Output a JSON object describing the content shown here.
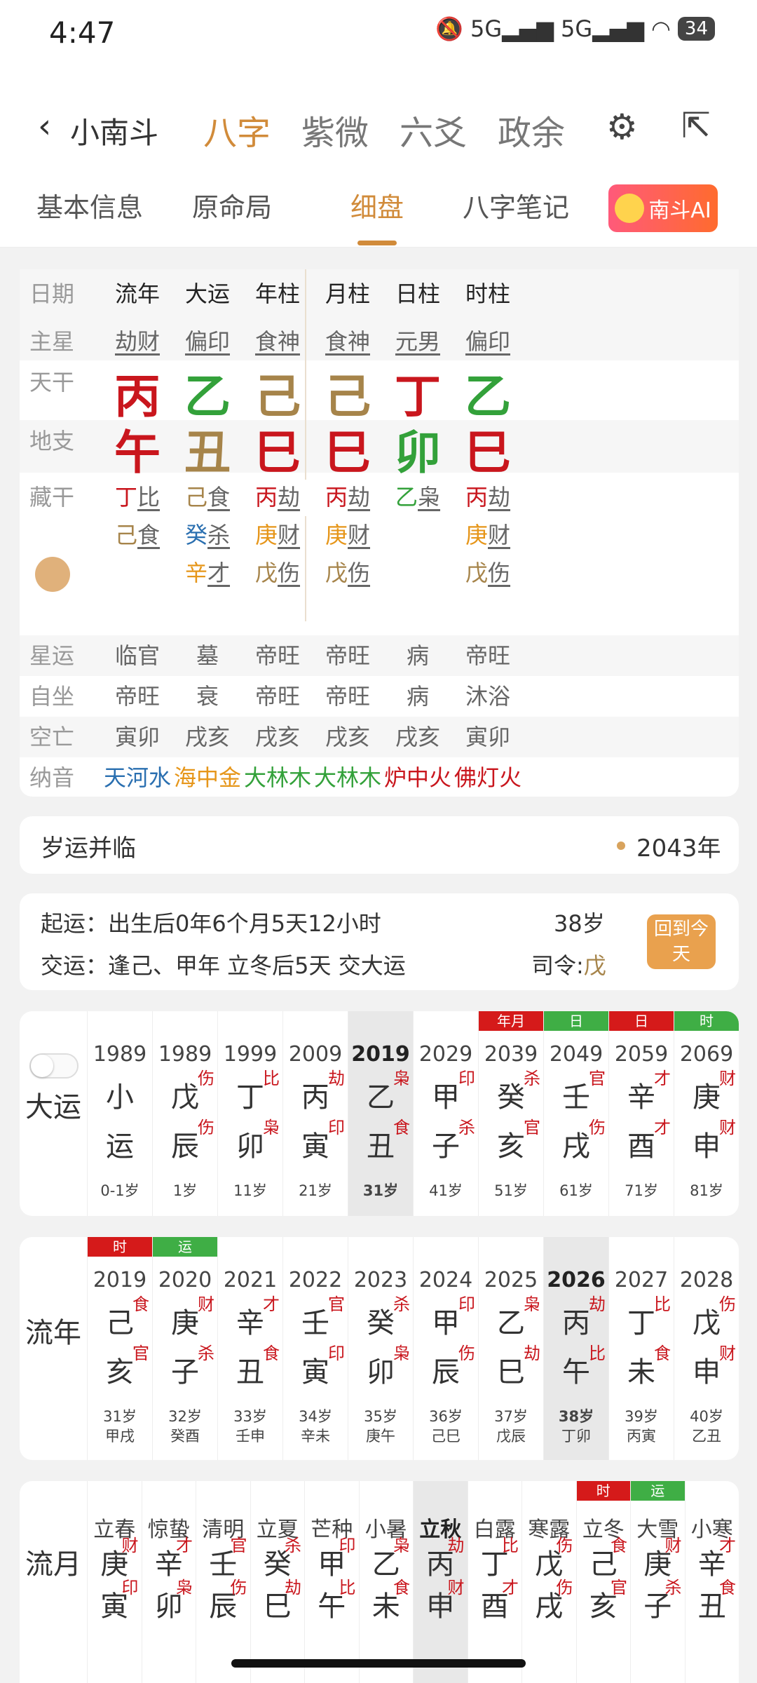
{
  "status": {
    "time": "4:47",
    "battery": "34",
    "net1": "5G",
    "net2": "5G"
  },
  "nav": {
    "back_label": "小南斗",
    "tabs": [
      "八字",
      "紫微",
      "六爻",
      "政余"
    ],
    "active": 0
  },
  "subtabs": {
    "items": [
      "基本信息",
      "原命局",
      "细盘",
      "八字笔记"
    ],
    "active": 2,
    "ai_label": "南斗AI"
  },
  "pan": {
    "labels": [
      "日期",
      "主星",
      "天干",
      "地支",
      "藏干",
      "星运",
      "自坐",
      "空亡",
      "纳音"
    ],
    "cols": [
      "流年",
      "大运",
      "年柱",
      "月柱",
      "日柱",
      "时柱"
    ],
    "zhuxing": [
      "劫财",
      "偏印",
      "食神",
      "食神",
      "元男",
      "偏印"
    ],
    "tiangan": [
      "丙",
      "乙",
      "己",
      "己",
      "丁",
      "乙"
    ],
    "dizhi": [
      "午",
      "丑",
      "巳",
      "巳",
      "卯",
      "巳"
    ],
    "canggan": [
      [
        [
          "丁",
          "比"
        ],
        [
          "己",
          "食"
        ]
      ],
      [
        [
          "己",
          "食"
        ],
        [
          "癸",
          "杀"
        ],
        [
          "辛",
          "才"
        ]
      ],
      [
        [
          "丙",
          "劫"
        ],
        [
          "庚",
          "财"
        ],
        [
          "戊",
          "伤"
        ]
      ],
      [
        [
          "丙",
          "劫"
        ],
        [
          "庚",
          "财"
        ],
        [
          "戊",
          "伤"
        ]
      ],
      [
        [
          "乙",
          "枭"
        ]
      ],
      [
        [
          "丙",
          "劫"
        ],
        [
          "庚",
          "财"
        ],
        [
          "戊",
          "伤"
        ]
      ]
    ],
    "xingyun": [
      "临官",
      "墓",
      "帝旺",
      "帝旺",
      "病",
      "帝旺"
    ],
    "zizuo": [
      "帝旺",
      "衰",
      "帝旺",
      "帝旺",
      "病",
      "沐浴"
    ],
    "kongwang": [
      "寅卯",
      "戌亥",
      "戌亥",
      "戌亥",
      "戌亥",
      "寅卯"
    ],
    "nayin": [
      "天河水",
      "海中金",
      "大林木",
      "大林木",
      "炉中火",
      "佛灯火"
    ]
  },
  "suiyun": {
    "title": "岁运并临",
    "year": "2043年"
  },
  "qiyun": {
    "line1": "起运：出生后0年6个月5天12小时",
    "age": "38岁",
    "line2": "交运：逢己、甲年 立冬后5天 交大运",
    "siling_label": "司令:",
    "siling_value": "戊",
    "today_btn": "回到今天"
  },
  "dayun": {
    "label": "大运",
    "cols": [
      {
        "year": "1989",
        "top": "小",
        "bot": "运",
        "ts": "",
        "bs": "",
        "age": "0-1岁",
        "tag": ""
      },
      {
        "year": "1989",
        "top": "戊",
        "bot": "辰",
        "ts": "伤",
        "bs": "伤",
        "age": "1岁",
        "tag": ""
      },
      {
        "year": "1999",
        "top": "丁",
        "bot": "卯",
        "ts": "比",
        "bs": "枭",
        "age": "11岁",
        "tag": ""
      },
      {
        "year": "2009",
        "top": "丙",
        "bot": "寅",
        "ts": "劫",
        "bs": "印",
        "age": "21岁",
        "tag": ""
      },
      {
        "year": "2019",
        "top": "乙",
        "bot": "丑",
        "ts": "枭",
        "bs": "食",
        "age": "31岁",
        "tag": "",
        "cur": true
      },
      {
        "year": "2029",
        "top": "甲",
        "bot": "子",
        "ts": "印",
        "bs": "杀",
        "age": "41岁",
        "tag": ""
      },
      {
        "year": "2039",
        "top": "癸",
        "bot": "亥",
        "ts": "杀",
        "bs": "官",
        "age": "51岁",
        "tag": "年月"
      },
      {
        "year": "2049",
        "top": "壬",
        "bot": "戌",
        "ts": "官",
        "bs": "伤",
        "age": "61岁",
        "tag": "日"
      },
      {
        "year": "2059",
        "top": "辛",
        "bot": "酉",
        "ts": "才",
        "bs": "才",
        "age": "71岁",
        "tag": "日"
      },
      {
        "year": "2069",
        "top": "庚",
        "bot": "申",
        "ts": "财",
        "bs": "财",
        "age": "81岁",
        "tag": "时"
      }
    ]
  },
  "liunian": {
    "label": "流年",
    "cols": [
      {
        "year": "2019",
        "top": "己",
        "bot": "亥",
        "ts": "食",
        "bs": "官",
        "age": "31岁",
        "gz": "甲戌",
        "tag": "时"
      },
      {
        "year": "2020",
        "top": "庚",
        "bot": "子",
        "ts": "财",
        "bs": "杀",
        "age": "32岁",
        "gz": "癸酉",
        "tag": "运"
      },
      {
        "year": "2021",
        "top": "辛",
        "bot": "丑",
        "ts": "才",
        "bs": "食",
        "age": "33岁",
        "gz": "壬申",
        "tag": ""
      },
      {
        "year": "2022",
        "top": "壬",
        "bot": "寅",
        "ts": "官",
        "bs": "印",
        "age": "34岁",
        "gz": "辛未",
        "tag": ""
      },
      {
        "year": "2023",
        "top": "癸",
        "bot": "卯",
        "ts": "杀",
        "bs": "枭",
        "age": "35岁",
        "gz": "庚午",
        "tag": ""
      },
      {
        "year": "2024",
        "top": "甲",
        "bot": "辰",
        "ts": "印",
        "bs": "伤",
        "age": "36岁",
        "gz": "己巳",
        "tag": ""
      },
      {
        "year": "2025",
        "top": "乙",
        "bot": "巳",
        "ts": "枭",
        "bs": "劫",
        "age": "37岁",
        "gz": "戊辰",
        "tag": ""
      },
      {
        "year": "2026",
        "top": "丙",
        "bot": "午",
        "ts": "劫",
        "bs": "比",
        "age": "38岁",
        "gz": "丁卯",
        "tag": "",
        "cur": true
      },
      {
        "year": "2027",
        "top": "丁",
        "bot": "未",
        "ts": "比",
        "bs": "食",
        "age": "39岁",
        "gz": "丙寅",
        "tag": ""
      },
      {
        "year": "2028",
        "top": "戊",
        "bot": "申",
        "ts": "伤",
        "bs": "财",
        "age": "40岁",
        "gz": "乙丑",
        "tag": ""
      }
    ]
  },
  "liuyue": {
    "label": "流月",
    "cols": [
      {
        "jq": "立春",
        "top": "庚",
        "bot": "寅",
        "ts": "财",
        "bs": "印",
        "tag": ""
      },
      {
        "jq": "惊蛰",
        "top": "辛",
        "bot": "卯",
        "ts": "才",
        "bs": "枭",
        "tag": ""
      },
      {
        "jq": "清明",
        "top": "壬",
        "bot": "辰",
        "ts": "官",
        "bs": "伤",
        "tag": ""
      },
      {
        "jq": "立夏",
        "top": "癸",
        "bot": "巳",
        "ts": "杀",
        "bs": "劫",
        "tag": ""
      },
      {
        "jq": "芒种",
        "top": "甲",
        "bot": "午",
        "ts": "印",
        "bs": "比",
        "tag": ""
      },
      {
        "jq": "小暑",
        "top": "乙",
        "bot": "未",
        "ts": "枭",
        "bs": "食",
        "tag": ""
      },
      {
        "jq": "立秋",
        "top": "丙",
        "bot": "申",
        "ts": "劫",
        "bs": "财",
        "tag": "",
        "cur": true
      },
      {
        "jq": "白露",
        "top": "丁",
        "bot": "酉",
        "ts": "比",
        "bs": "才",
        "tag": ""
      },
      {
        "jq": "寒露",
        "top": "戊",
        "bot": "戌",
        "ts": "伤",
        "bs": "伤",
        "tag": ""
      },
      {
        "jq": "立冬",
        "top": "己",
        "bot": "亥",
        "ts": "食",
        "bs": "官",
        "tag": "时"
      },
      {
        "jq": "大雪",
        "top": "庚",
        "bot": "子",
        "ts": "财",
        "bs": "杀",
        "tag": "运"
      },
      {
        "jq": "小寒",
        "top": "辛",
        "bot": "丑",
        "ts": "才",
        "bs": "食",
        "tag": ""
      }
    ]
  },
  "colors": {
    "accent": "#d18b3a",
    "red": "#c9161d",
    "green": "#33a13a",
    "gold": "#a6844a"
  }
}
